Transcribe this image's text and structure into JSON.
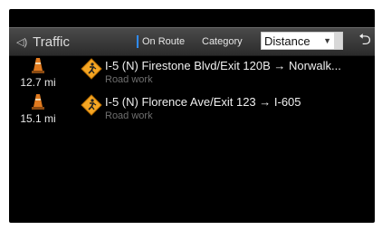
{
  "header": {
    "title": "Traffic",
    "tabs": {
      "on_route": "On Route",
      "category": "Category"
    },
    "sort_dropdown": {
      "value": "Distance"
    }
  },
  "incidents": [
    {
      "distance": "12.7 mi",
      "road": "I-5 (N) Firestone Blvd/Exit 120B → Norwalk...",
      "type": "Road work"
    },
    {
      "distance": "15.1 mi",
      "road": "I-5 (N) Florence Ave/Exit 123 → I-605",
      "type": "Road work"
    }
  ],
  "colors": {
    "accent": "#2f8cff",
    "warning": "#f5a623",
    "cone": "#e07a1f"
  },
  "icons": [
    "radio-icon",
    "traffic-cone-icon",
    "road-work-warning-icon",
    "back-icon",
    "dropdown-caret-icon"
  ]
}
